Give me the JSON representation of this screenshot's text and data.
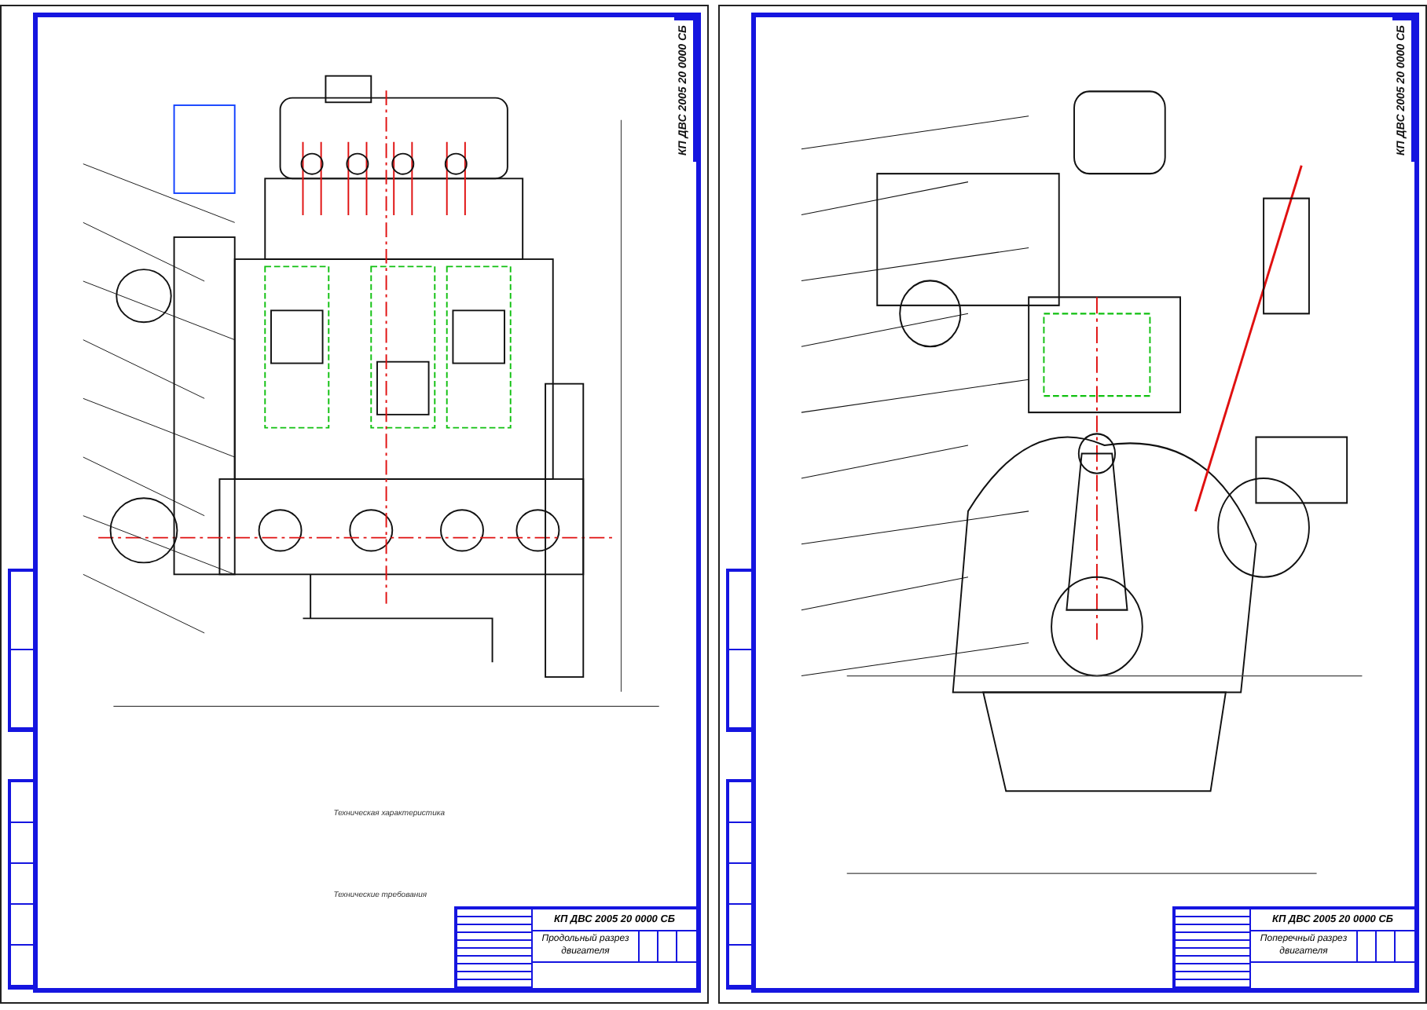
{
  "sheets": [
    {
      "kind": "longitudinal",
      "stamp": "КП ДВС 2005 20 0000 СБ",
      "notes": [
        "Техническая характеристика",
        "Технические требования"
      ],
      "title_block": {
        "code": "КП ДВС 2005 20 0000 СБ",
        "title": "Продольный разрез двигателя"
      }
    },
    {
      "kind": "transverse",
      "stamp": "КП ДВС 2005 20 0000 СБ",
      "title_block": {
        "code": "КП ДВС 2005 20 0000 СБ",
        "title": "Поперечный разрез двигателя"
      }
    }
  ]
}
